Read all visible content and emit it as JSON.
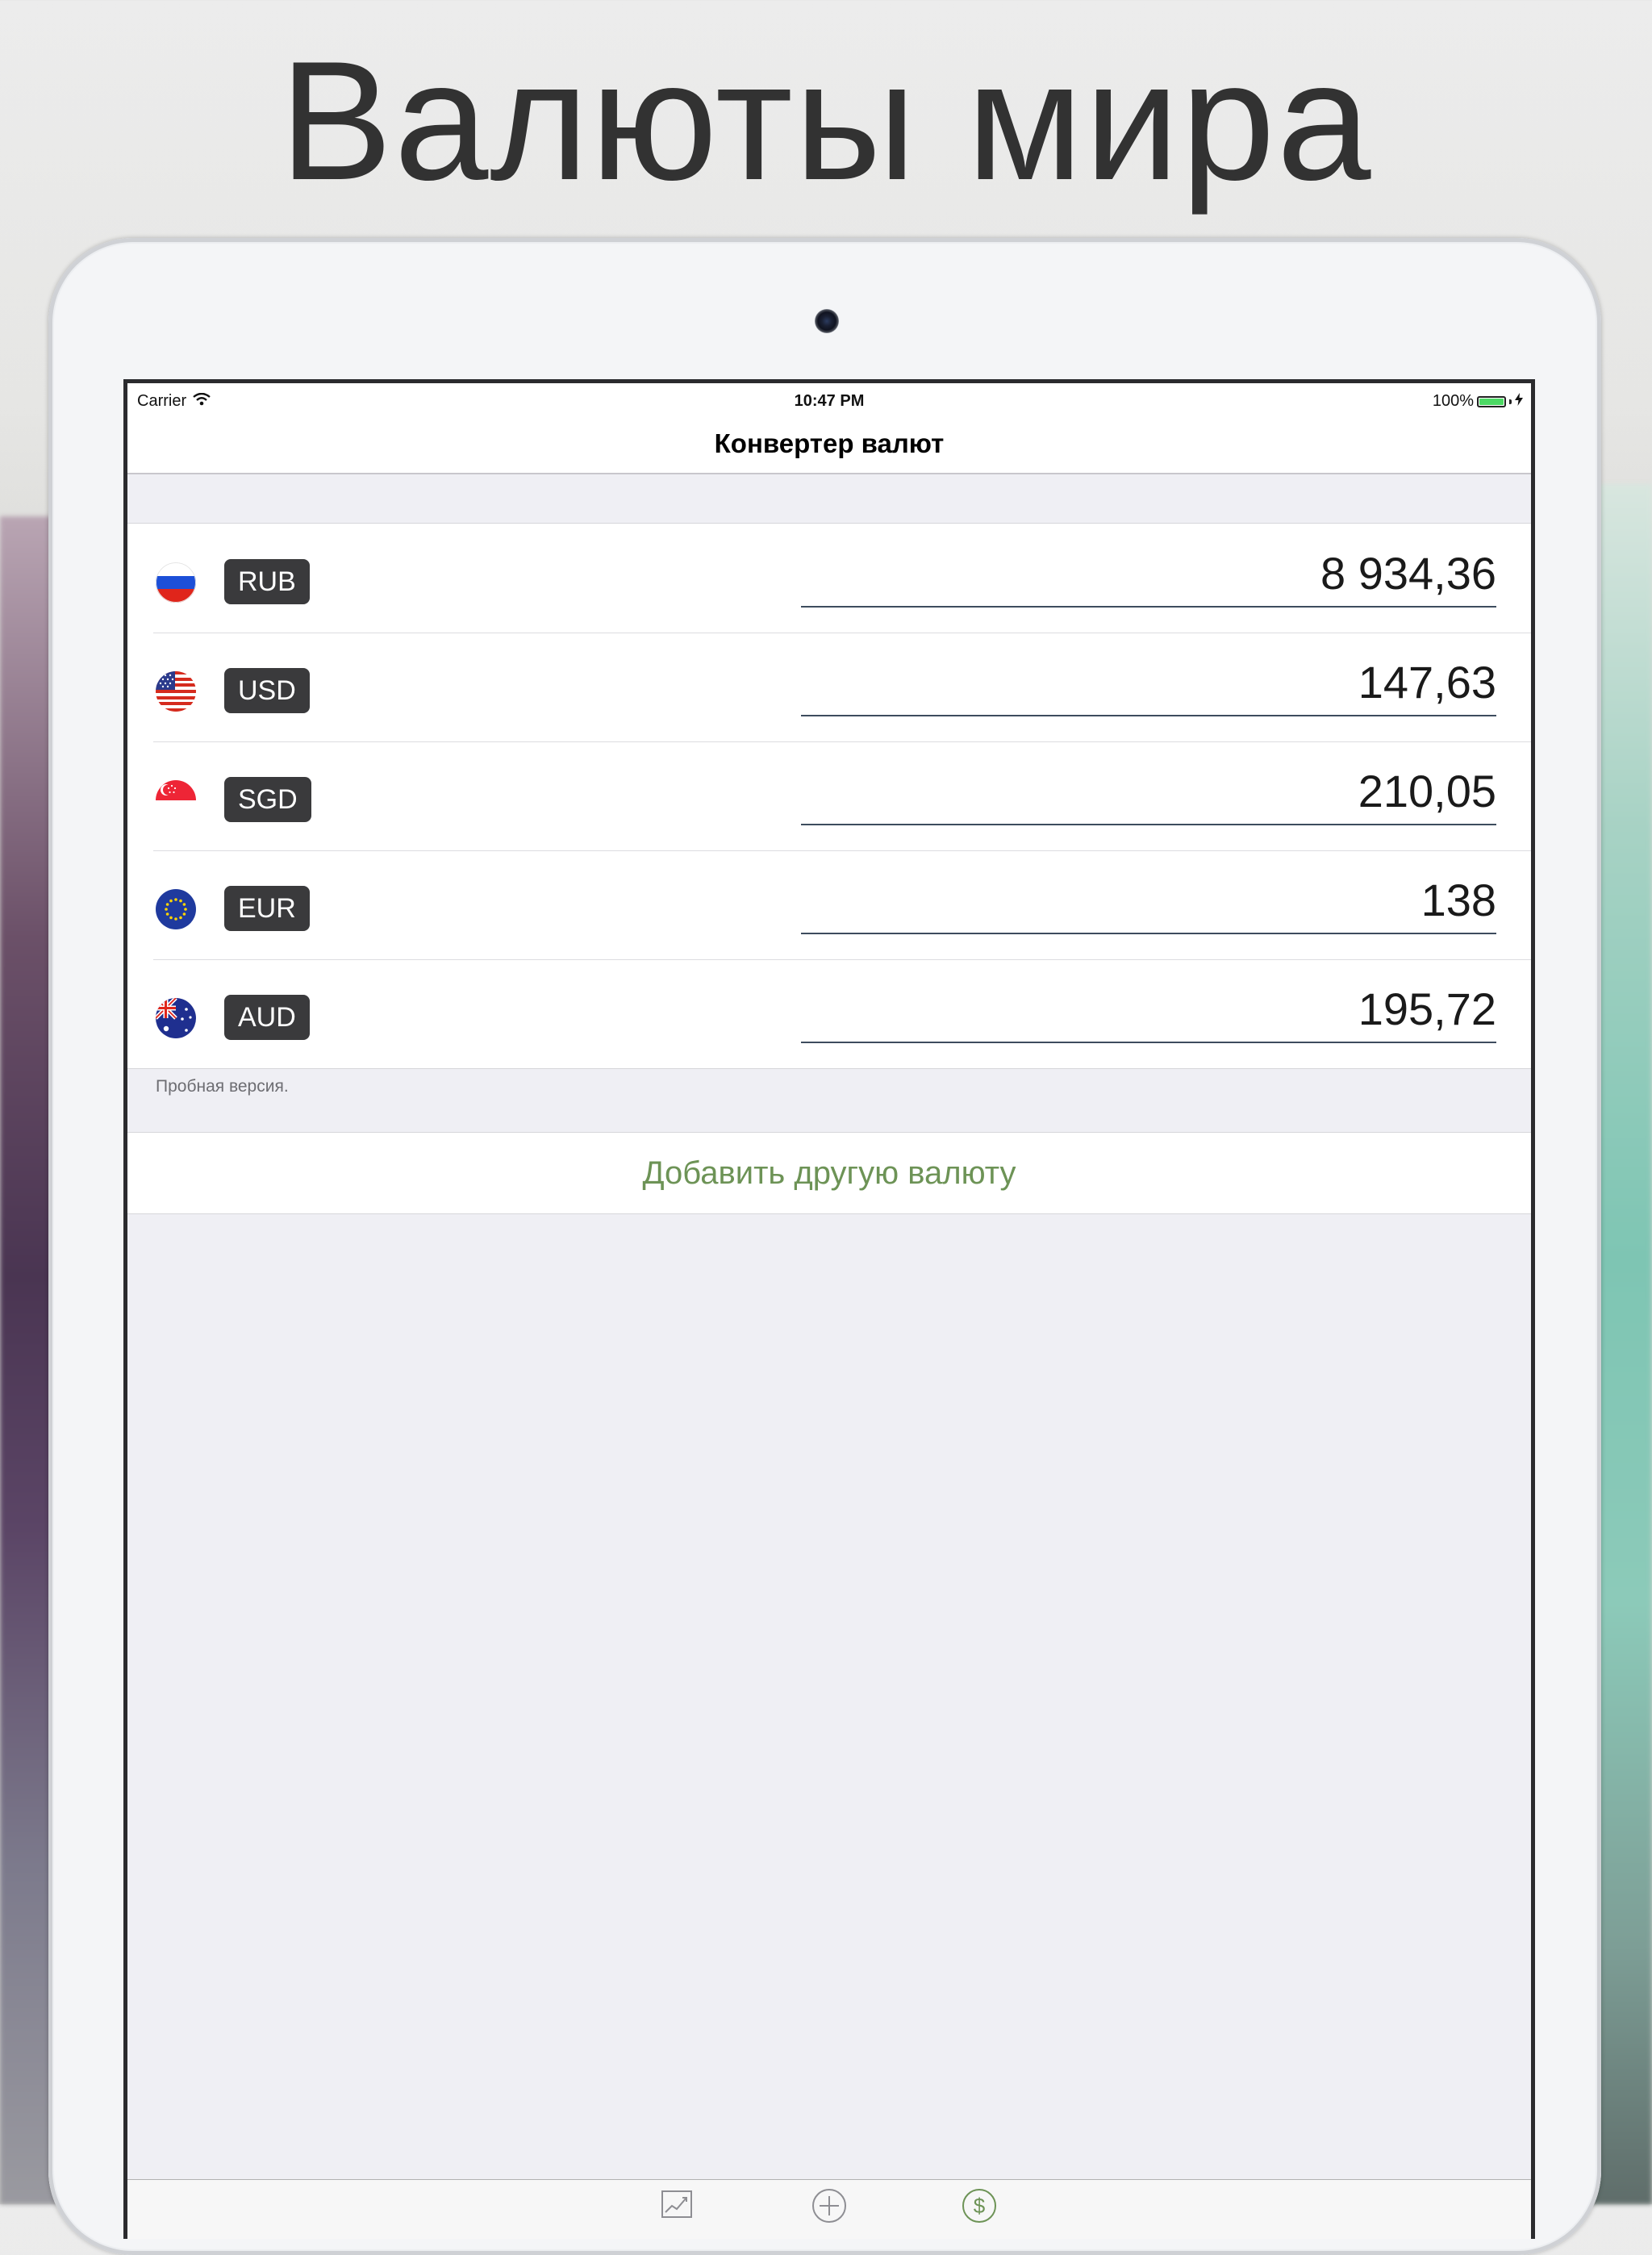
{
  "headline": "Валюты мира",
  "status_bar": {
    "carrier": "Carrier",
    "time": "10:47 PM",
    "battery": "100%"
  },
  "nav": {
    "title": "Конвертер валют"
  },
  "currencies": [
    {
      "code": "RUB",
      "flag": "russia-flag-icon",
      "amount": "8 934,36"
    },
    {
      "code": "USD",
      "flag": "usa-flag-icon",
      "amount": "147,63"
    },
    {
      "code": "SGD",
      "flag": "singapore-flag-icon",
      "amount": "210,05"
    },
    {
      "code": "EUR",
      "flag": "eu-flag-icon",
      "amount": "138"
    },
    {
      "code": "AUD",
      "flag": "australia-flag-icon",
      "amount": "195,72"
    }
  ],
  "trial_note": "Пробная версия.",
  "add_button": "Добавить другую валюту",
  "tabs": [
    {
      "icon": "chart-icon",
      "active": false
    },
    {
      "icon": "add-circle-icon",
      "active": false
    },
    {
      "icon": "dollar-circle-icon",
      "active": true
    }
  ],
  "colors": {
    "accent_green": "#6d9356",
    "badge_bg": "#3a3a3c",
    "battery_green": "#4cd964",
    "tab_active": "#6d9356",
    "tab_inactive": "#8e8e93"
  }
}
